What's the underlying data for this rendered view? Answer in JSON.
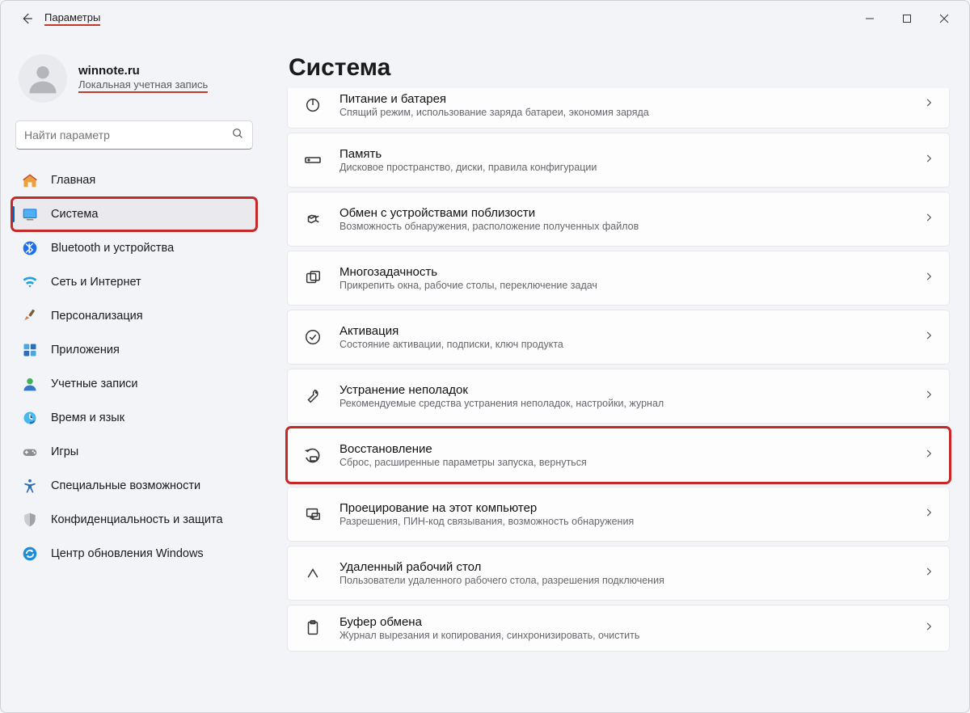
{
  "titlebar": {
    "title": "Параметры"
  },
  "account": {
    "name": "winnote.ru",
    "subtitle": "Локальная учетная запись"
  },
  "search": {
    "placeholder": "Найти параметр"
  },
  "sidebar": {
    "items": [
      {
        "icon": "home",
        "label": "Главная"
      },
      {
        "icon": "system",
        "label": "Система",
        "selected": true,
        "highlight": true
      },
      {
        "icon": "bluetooth",
        "label": "Bluetooth и устройства"
      },
      {
        "icon": "network",
        "label": "Сеть и Интернет"
      },
      {
        "icon": "personalize",
        "label": "Персонализация"
      },
      {
        "icon": "apps",
        "label": "Приложения"
      },
      {
        "icon": "accounts",
        "label": "Учетные записи"
      },
      {
        "icon": "time",
        "label": "Время и язык"
      },
      {
        "icon": "gaming",
        "label": "Игры"
      },
      {
        "icon": "accessibility",
        "label": "Специальные возможности"
      },
      {
        "icon": "privacy",
        "label": "Конфиденциальность и защита"
      },
      {
        "icon": "update",
        "label": "Центр обновления Windows"
      }
    ]
  },
  "page": {
    "title": "Система",
    "panels": [
      {
        "icon": "power",
        "title": "Питание и батарея",
        "sub": "Спящий режим, использование заряда батареи, экономия заряда",
        "cutoffTop": true
      },
      {
        "icon": "storage",
        "title": "Память",
        "sub": "Дисковое пространство, диски, правила конфигурации"
      },
      {
        "icon": "share",
        "title": "Обмен с устройствами поблизости",
        "sub": "Возможность обнаружения, расположение полученных файлов"
      },
      {
        "icon": "multitask",
        "title": "Многозадачность",
        "sub": "Прикрепить окна, рабочие столы, переключение задач"
      },
      {
        "icon": "activation",
        "title": "Активация",
        "sub": "Состояние активации, подписки, ключ продукта"
      },
      {
        "icon": "troubleshoot",
        "title": "Устранение неполадок",
        "sub": "Рекомендуемые средства устранения неполадок, настройки, журнал"
      },
      {
        "icon": "recovery",
        "title": "Восстановление",
        "sub": "Сброс, расширенные параметры запуска, вернуться",
        "highlight": true
      },
      {
        "icon": "project",
        "title": "Проецирование на этот компьютер",
        "sub": "Разрешения, ПИН-код связывания, возможность обнаружения"
      },
      {
        "icon": "remote",
        "title": "Удаленный рабочий стол",
        "sub": "Пользователи удаленного рабочего стола, разрешения подключения"
      },
      {
        "icon": "clipboard",
        "title": "Буфер обмена",
        "sub": "Журнал вырезания и копирования, синхронизировать, очистить",
        "cutoffBottom": true
      }
    ]
  }
}
